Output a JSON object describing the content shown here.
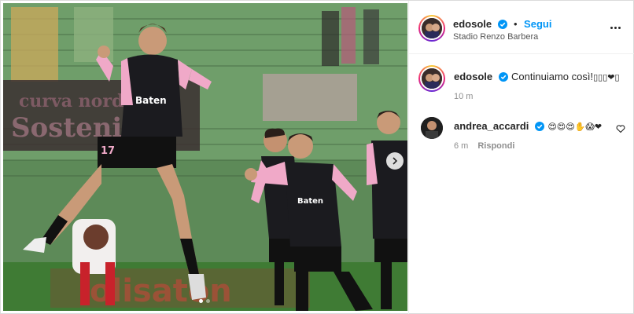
{
  "post": {
    "username": "edosole",
    "follow_label": "Segui",
    "separator": "•",
    "location": "Stadio Renzo Barbera"
  },
  "caption": {
    "username": "edosole",
    "text": "Continuiamo così!",
    "emojis": "▯▯▯❤▯",
    "time": "10 m"
  },
  "comments": [
    {
      "username": "andrea_accardi",
      "emojis": "😍😍😍✋😱❤",
      "time": "6 m",
      "reply_label": "Rispondi"
    }
  ],
  "media": {
    "slides": 2,
    "active_slide": 1,
    "shirt_numbers": [
      "17"
    ],
    "sponsor_text": "Baten",
    "banner_text": "olisaton"
  },
  "icons": {
    "verified": "verified-badge-icon",
    "more": "more-options-icon",
    "like": "heart-icon",
    "next": "chevron-right-icon"
  },
  "colors": {
    "accent": "#0095f6",
    "muted": "#8e8e8e",
    "jersey_pink": "#f0a9c8",
    "jersey_black": "#1b1b1f"
  }
}
